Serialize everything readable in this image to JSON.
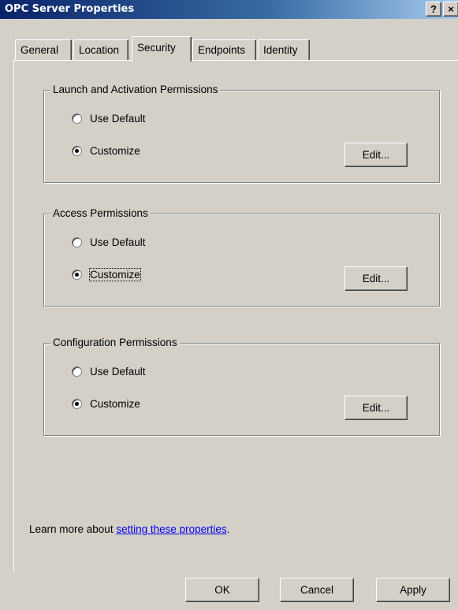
{
  "window": {
    "title": "OPC Server Properties",
    "help_button": "?",
    "close_button": "×"
  },
  "tabs": [
    {
      "label": "General",
      "active": false
    },
    {
      "label": "Location",
      "active": false
    },
    {
      "label": "Security",
      "active": true
    },
    {
      "label": "Endpoints",
      "active": false
    },
    {
      "label": "Identity",
      "active": false
    }
  ],
  "groups": {
    "launch": {
      "title": "Launch and Activation Permissions",
      "use_default": "Use Default",
      "customize": "Customize",
      "selected": "Customize",
      "edit": "Edit..."
    },
    "access": {
      "title": "Access Permissions",
      "use_default": "Use Default",
      "customize": "Customize",
      "selected": "Customize",
      "edit": "Edit..."
    },
    "configuration": {
      "title": "Configuration Permissions",
      "use_default": "Use Default",
      "customize": "Customize",
      "selected": "Customize",
      "edit": "Edit..."
    }
  },
  "learn_more": {
    "prefix": "Learn more about ",
    "link": "setting these properties",
    "suffix": "."
  },
  "buttons": {
    "ok": "OK",
    "cancel": "Cancel",
    "apply": "Apply"
  }
}
